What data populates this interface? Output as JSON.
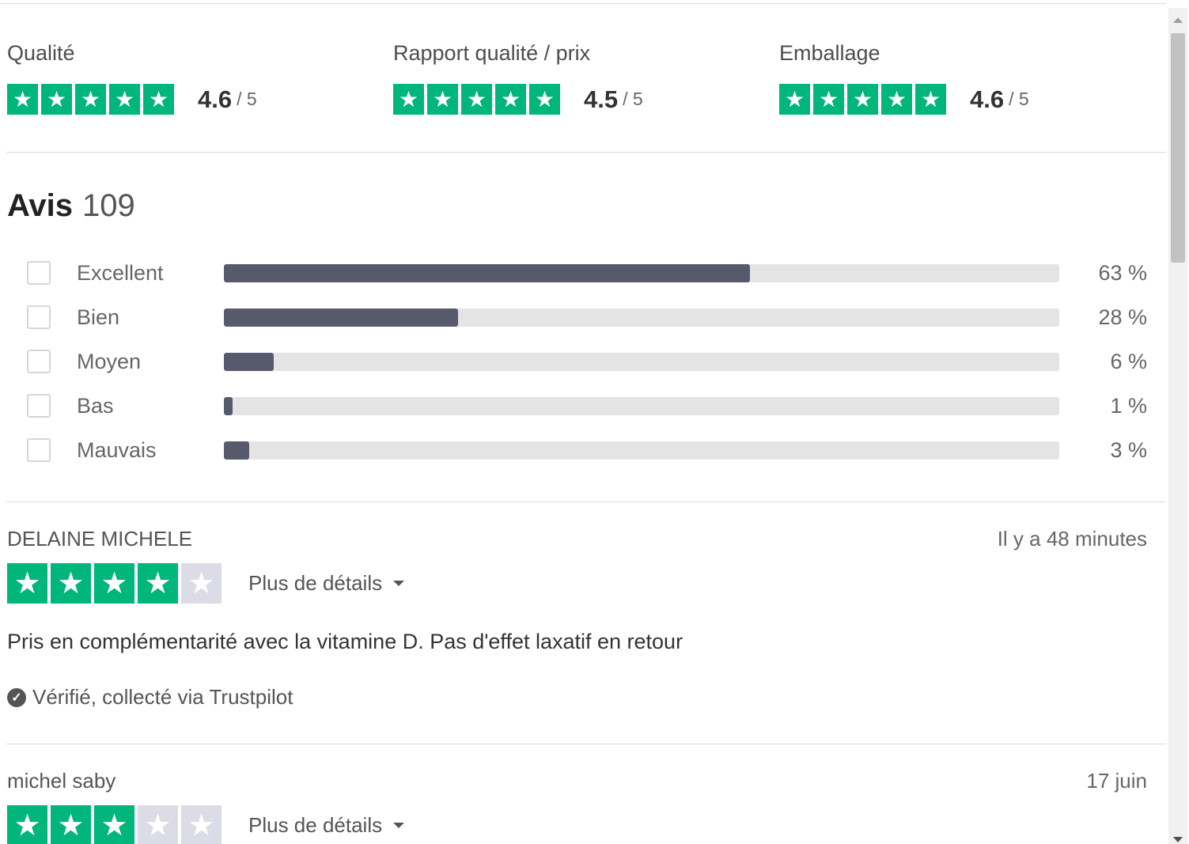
{
  "categories": [
    {
      "label": "Qualité",
      "score": "4.6",
      "max": "/ 5",
      "stars": [
        1,
        1,
        1,
        1,
        1
      ]
    },
    {
      "label": "Rapport qualité / prix",
      "score": "4.5",
      "max": "/ 5",
      "stars": [
        1,
        1,
        1,
        1,
        1
      ]
    },
    {
      "label": "Emballage",
      "score": "4.6",
      "max": "/ 5",
      "stars": [
        1,
        1,
        1,
        1,
        1
      ]
    }
  ],
  "reviews_header": {
    "title": "Avis",
    "count": "109"
  },
  "distribution": [
    {
      "label": "Excellent",
      "percent_text": "63 %",
      "percent": 63
    },
    {
      "label": "Bien",
      "percent_text": "28 %",
      "percent": 28
    },
    {
      "label": "Moyen",
      "percent_text": "6 %",
      "percent": 6
    },
    {
      "label": "Bas",
      "percent_text": "1 %",
      "percent": 1
    },
    {
      "label": "Mauvais",
      "percent_text": "3 %",
      "percent": 3
    }
  ],
  "reviews": [
    {
      "author": "DELAINE MICHELE",
      "date": "Il y a 48 minutes",
      "rating": 4,
      "details_label": "Plus de détails",
      "text": "Pris en complémentarité avec la vitamine D. Pas d'effet laxatif en retour",
      "verified": "Vérifié, collecté via Trustpilot"
    },
    {
      "author": "michel saby",
      "date": "17 juin",
      "rating": 3,
      "details_label": "Plus de détails"
    }
  ],
  "colors": {
    "star_on": "#00b67a",
    "star_off": "#dcdce6",
    "bar_fill": "#575a6d",
    "bar_track": "#e4e4e4"
  },
  "icons": {
    "star": "star-icon",
    "verified": "check-circle-icon",
    "caret": "caret-down-icon"
  }
}
